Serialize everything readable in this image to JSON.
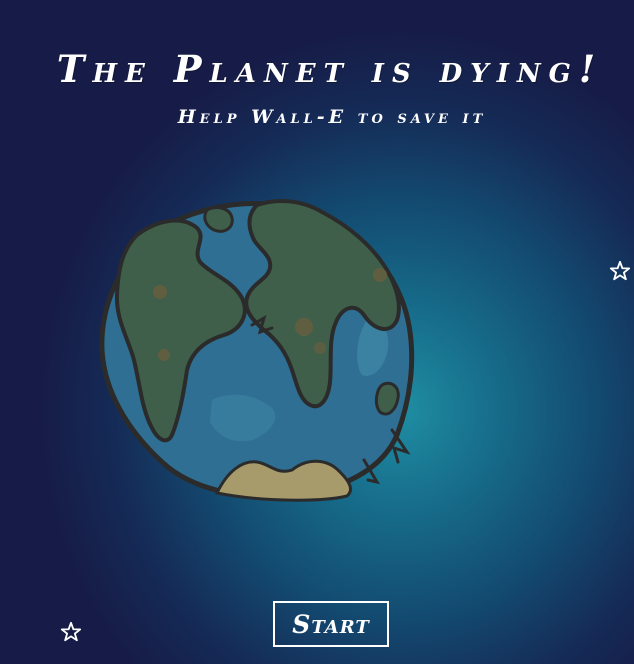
{
  "header": {
    "title": "The Planet is dying!",
    "subtitle": "Help Wall-E to save it"
  },
  "actions": {
    "start_label": "Start"
  },
  "decor": {
    "planet_icon": "earth-icon",
    "star_icon": "star-icon"
  },
  "colors": {
    "background_center": "#1f8ea3",
    "background_edge": "#161c47",
    "ocean": "#2f6f93",
    "land": "#3f5f4a",
    "sand": "#a79a6b",
    "outline": "#2b2b2b",
    "text": "#ffffff"
  }
}
